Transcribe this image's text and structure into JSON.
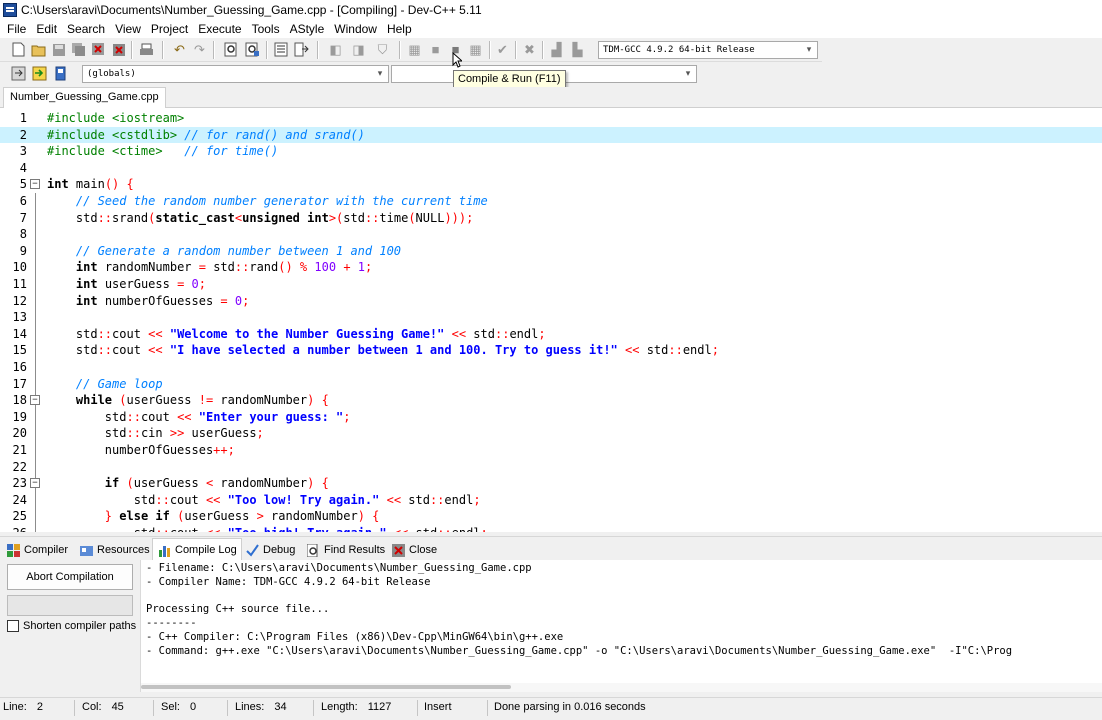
{
  "window": {
    "title": "C:\\Users\\aravi\\Documents\\Number_Guessing_Game.cpp - [Compiling] - Dev-C++ 5.11"
  },
  "menu": [
    "File",
    "Edit",
    "Search",
    "View",
    "Project",
    "Execute",
    "Tools",
    "AStyle",
    "Window",
    "Help"
  ],
  "toolbar": {
    "compiler_select": "TDM-GCC 4.9.2 64-bit Release",
    "scope_select": "(globals)",
    "member_select": "",
    "tooltip": "Compile & Run (F11)"
  },
  "file_tab": "Number_Guessing_Game.cpp",
  "editor": {
    "active_line": 2,
    "lines": [
      {
        "n": "1",
        "segs": [
          [
            "pp",
            "#include <iostream>"
          ]
        ]
      },
      {
        "n": "2",
        "segs": [
          [
            "pp",
            "#include <cstdlib> "
          ],
          [
            "cm",
            "// for rand() and srand()"
          ]
        ]
      },
      {
        "n": "3",
        "segs": [
          [
            "pp",
            "#include <ctime>   "
          ],
          [
            "cm",
            "// for time()"
          ]
        ]
      },
      {
        "n": "4",
        "segs": []
      },
      {
        "n": "5",
        "segs": [
          [
            "kw",
            "int"
          ],
          [
            "",
            " main"
          ],
          [
            "op",
            "() {"
          ]
        ]
      },
      {
        "n": "6",
        "segs": [
          [
            "",
            "    "
          ],
          [
            "cm",
            "// Seed the random number generator with the current time"
          ]
        ]
      },
      {
        "n": "7",
        "segs": [
          [
            "",
            "    std"
          ],
          [
            "op",
            "::"
          ],
          [
            "",
            "srand"
          ],
          [
            "op",
            "("
          ],
          [
            "kw",
            "static_cast"
          ],
          [
            "op",
            "<"
          ],
          [
            "kw",
            "unsigned int"
          ],
          [
            "op",
            ">("
          ],
          [
            "",
            "std"
          ],
          [
            "op",
            "::"
          ],
          [
            "",
            "time"
          ],
          [
            "op",
            "("
          ],
          [
            "",
            "NULL"
          ],
          [
            "op",
            ")));"
          ]
        ]
      },
      {
        "n": "8",
        "segs": []
      },
      {
        "n": "9",
        "segs": [
          [
            "",
            "    "
          ],
          [
            "cm",
            "// Generate a random number between 1 and 100"
          ]
        ]
      },
      {
        "n": "10",
        "segs": [
          [
            "",
            "    "
          ],
          [
            "kw",
            "int"
          ],
          [
            "",
            " randomNumber "
          ],
          [
            "op",
            "="
          ],
          [
            "",
            " std"
          ],
          [
            "op",
            "::"
          ],
          [
            "",
            "rand"
          ],
          [
            "op",
            "() %"
          ],
          [
            "",
            " "
          ],
          [
            "num",
            "100"
          ],
          [
            "",
            " "
          ],
          [
            "op",
            "+"
          ],
          [
            "",
            " "
          ],
          [
            "num",
            "1"
          ],
          [
            "op",
            ";"
          ]
        ]
      },
      {
        "n": "11",
        "segs": [
          [
            "",
            "    "
          ],
          [
            "kw",
            "int"
          ],
          [
            "",
            " userGuess "
          ],
          [
            "op",
            "="
          ],
          [
            "",
            " "
          ],
          [
            "num",
            "0"
          ],
          [
            "op",
            ";"
          ]
        ]
      },
      {
        "n": "12",
        "segs": [
          [
            "",
            "    "
          ],
          [
            "kw",
            "int"
          ],
          [
            "",
            " numberOfGuesses "
          ],
          [
            "op",
            "="
          ],
          [
            "",
            " "
          ],
          [
            "num",
            "0"
          ],
          [
            "op",
            ";"
          ]
        ]
      },
      {
        "n": "13",
        "segs": []
      },
      {
        "n": "14",
        "segs": [
          [
            "",
            "    std"
          ],
          [
            "op",
            "::"
          ],
          [
            "",
            "cout "
          ],
          [
            "op",
            "<<"
          ],
          [
            "",
            " "
          ],
          [
            "st",
            "\"Welcome to the Number Guessing Game!\""
          ],
          [
            "",
            " "
          ],
          [
            "op",
            "<<"
          ],
          [
            "",
            " std"
          ],
          [
            "op",
            "::"
          ],
          [
            "",
            "endl"
          ],
          [
            "op",
            ";"
          ]
        ]
      },
      {
        "n": "15",
        "segs": [
          [
            "",
            "    std"
          ],
          [
            "op",
            "::"
          ],
          [
            "",
            "cout "
          ],
          [
            "op",
            "<<"
          ],
          [
            "",
            " "
          ],
          [
            "st",
            "\"I have selected a number between 1 and 100. Try to guess it!\""
          ],
          [
            "",
            " "
          ],
          [
            "op",
            "<<"
          ],
          [
            "",
            " std"
          ],
          [
            "op",
            "::"
          ],
          [
            "",
            "endl"
          ],
          [
            "op",
            ";"
          ]
        ]
      },
      {
        "n": "16",
        "segs": []
      },
      {
        "n": "17",
        "segs": [
          [
            "",
            "    "
          ],
          [
            "cm",
            "// Game loop"
          ]
        ]
      },
      {
        "n": "18",
        "segs": [
          [
            "",
            "    "
          ],
          [
            "kw",
            "while"
          ],
          [
            "",
            " "
          ],
          [
            "op",
            "("
          ],
          [
            "",
            "userGuess "
          ],
          [
            "op",
            "!="
          ],
          [
            "",
            " randomNumber"
          ],
          [
            "op",
            ") {"
          ]
        ]
      },
      {
        "n": "19",
        "segs": [
          [
            "",
            "        std"
          ],
          [
            "op",
            "::"
          ],
          [
            "",
            "cout "
          ],
          [
            "op",
            "<<"
          ],
          [
            "",
            " "
          ],
          [
            "st",
            "\"Enter your guess: \""
          ],
          [
            "op",
            ";"
          ]
        ]
      },
      {
        "n": "20",
        "segs": [
          [
            "",
            "        std"
          ],
          [
            "op",
            "::"
          ],
          [
            "",
            "cin "
          ],
          [
            "op",
            ">>"
          ],
          [
            "",
            " userGuess"
          ],
          [
            "op",
            ";"
          ]
        ]
      },
      {
        "n": "21",
        "segs": [
          [
            "",
            "        numberOfGuesses"
          ],
          [
            "op",
            "++;"
          ]
        ]
      },
      {
        "n": "22",
        "segs": []
      },
      {
        "n": "23",
        "segs": [
          [
            "",
            "        "
          ],
          [
            "kw",
            "if"
          ],
          [
            "",
            " "
          ],
          [
            "op",
            "("
          ],
          [
            "",
            "userGuess "
          ],
          [
            "op",
            "<"
          ],
          [
            "",
            " randomNumber"
          ],
          [
            "op",
            ") {"
          ]
        ]
      },
      {
        "n": "24",
        "segs": [
          [
            "",
            "            std"
          ],
          [
            "op",
            "::"
          ],
          [
            "",
            "cout "
          ],
          [
            "op",
            "<<"
          ],
          [
            "",
            " "
          ],
          [
            "st",
            "\"Too low! Try again.\""
          ],
          [
            "",
            " "
          ],
          [
            "op",
            "<<"
          ],
          [
            "",
            " std"
          ],
          [
            "op",
            "::"
          ],
          [
            "",
            "endl"
          ],
          [
            "op",
            ";"
          ]
        ]
      },
      {
        "n": "25",
        "segs": [
          [
            "",
            "        "
          ],
          [
            "op",
            "}"
          ],
          [
            "",
            " "
          ],
          [
            "kw",
            "else if"
          ],
          [
            "",
            " "
          ],
          [
            "op",
            "("
          ],
          [
            "",
            "userGuess "
          ],
          [
            "op",
            ">"
          ],
          [
            "",
            " randomNumber"
          ],
          [
            "op",
            ") {"
          ]
        ]
      },
      {
        "n": "26",
        "segs": [
          [
            "",
            "            std"
          ],
          [
            "op",
            "::"
          ],
          [
            "",
            "cout "
          ],
          [
            "op",
            "<<"
          ],
          [
            "",
            " "
          ],
          [
            "st",
            "\"Too high! Try again.\""
          ],
          [
            "",
            " "
          ],
          [
            "op",
            "<<"
          ],
          [
            "",
            " std"
          ],
          [
            "op",
            "::"
          ],
          [
            "",
            "endl"
          ],
          [
            "op",
            ";"
          ]
        ]
      }
    ]
  },
  "bottom_tabs": [
    "Compiler",
    "Resources",
    "Compile Log",
    "Debug",
    "Find Results",
    "Close"
  ],
  "active_bottom_tab": "Compile Log",
  "left_pane": {
    "abort_label": "Abort Compilation",
    "shorten_label": "Shorten compiler paths"
  },
  "log_lines": [
    "- Filename: C:\\Users\\aravi\\Documents\\Number_Guessing_Game.cpp",
    "- Compiler Name: TDM-GCC 4.9.2 64-bit Release",
    "",
    "Processing C++ source file...",
    "--------",
    "- C++ Compiler: C:\\Program Files (x86)\\Dev-Cpp\\MinGW64\\bin\\g++.exe",
    "- Command: g++.exe \"C:\\Users\\aravi\\Documents\\Number_Guessing_Game.cpp\" -o \"C:\\Users\\aravi\\Documents\\Number_Guessing_Game.exe\"  -I\"C:\\Prog"
  ],
  "status": {
    "line_label": "Line:",
    "line": "2",
    "col_label": "Col:",
    "col": "45",
    "sel_label": "Sel:",
    "sel": "0",
    "lines_label": "Lines:",
    "lines": "34",
    "length_label": "Length:",
    "length": "1127",
    "mode": "Insert",
    "message": "Done parsing in 0.016 seconds"
  }
}
